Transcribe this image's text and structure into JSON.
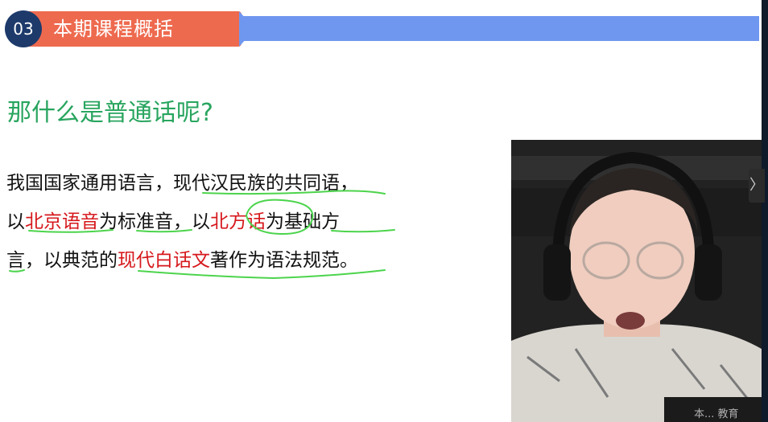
{
  "header": {
    "section_number": "03",
    "section_title": "本期课程概括"
  },
  "question": "那什么是普通话呢?",
  "paragraph": {
    "line1": {
      "part1": "我国国家通用语言，现代汉民族的共同语，"
    },
    "line2": {
      "part1": "以",
      "red1": "北京语音",
      "part2": "为标准音，以",
      "red2": "北方话",
      "part3": "为基础方"
    },
    "line3": {
      "part1": "言，以典范的",
      "red1": "现代白话文",
      "part2": "著作为语法规范。"
    }
  },
  "webcam": {
    "expand_icon": "chevron-right-icon",
    "watermark": "本... 教育"
  },
  "colors": {
    "header_blue": "#6f97f0",
    "header_orange": "#ee6a4f",
    "badge_navy": "#1d3a6b",
    "question_green": "#29a55f",
    "highlight_red": "#d6181c",
    "annotation_green": "#4cd44c"
  }
}
